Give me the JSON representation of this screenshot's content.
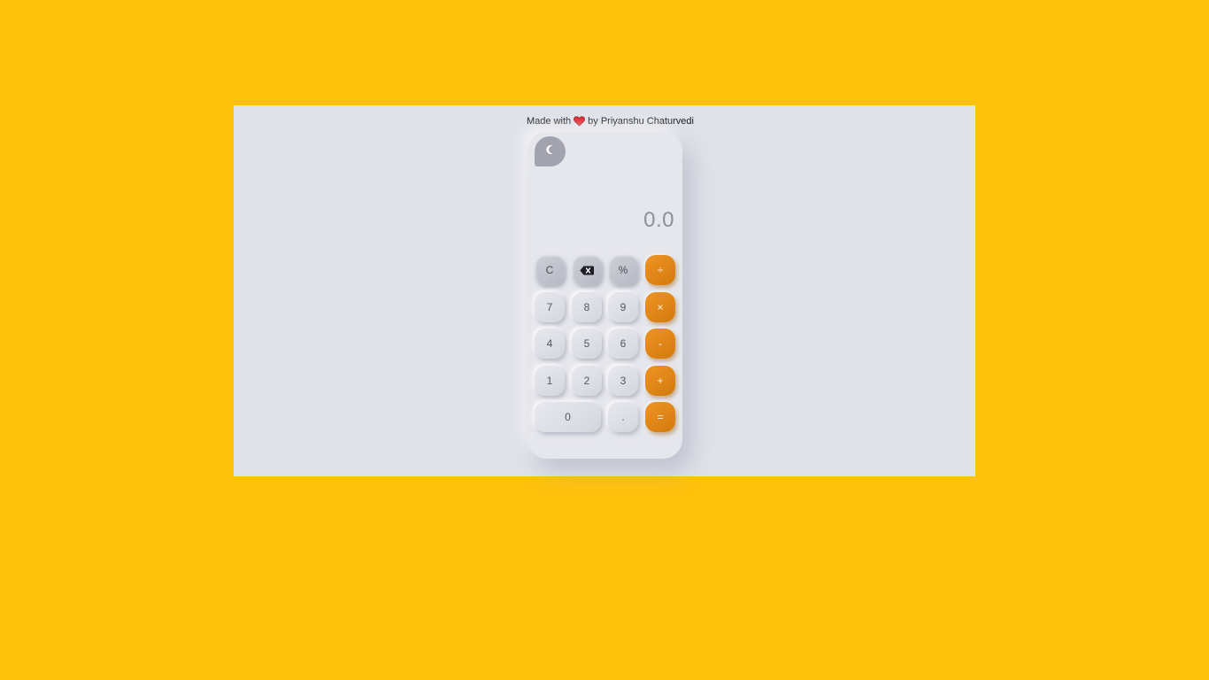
{
  "credit": {
    "prefix": "Made with",
    "suffix": "by Priyanshu Chaturvedi"
  },
  "icons": {
    "heart": "heart-icon",
    "theme": "moon-icon",
    "backspace": "backspace-icon"
  },
  "colors": {
    "page_bg": "#ffc20c",
    "panel_bg": "#e0e2ea",
    "accent_orange": "#e3871a",
    "toggle_bg": "#a3a3b0",
    "heart": "#e0202e"
  },
  "display": {
    "value": "0.0"
  },
  "keys": {
    "clear": "C",
    "percent": "%",
    "divide": "÷",
    "seven": "7",
    "eight": "8",
    "nine": "9",
    "multiply": "×",
    "four": "4",
    "five": "5",
    "six": "6",
    "minus": "-",
    "one": "1",
    "two": "2",
    "three": "3",
    "plus": "+",
    "zero": "0",
    "dot": ".",
    "equals": "="
  }
}
